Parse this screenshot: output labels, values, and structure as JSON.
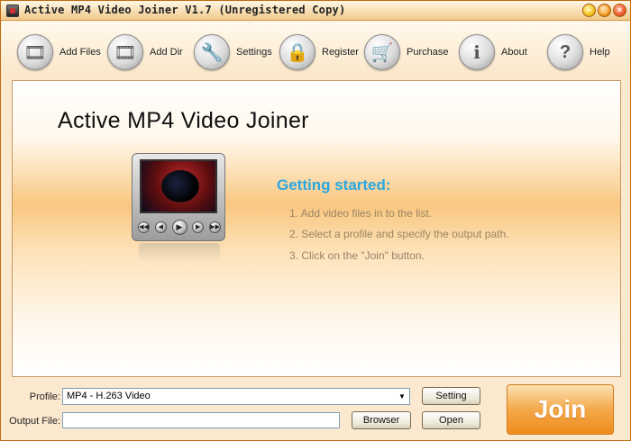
{
  "window": {
    "title": "Active MP4 Video Joiner V1.7 (Unregistered Copy)"
  },
  "toolbar": {
    "items": [
      {
        "label": "Add Files",
        "icon": "film-add-icon"
      },
      {
        "label": "Add Dir",
        "icon": "film-folder-icon"
      },
      {
        "label": "Settings",
        "icon": "wrench-icon"
      },
      {
        "label": "Register",
        "icon": "lock-icon"
      },
      {
        "label": "Purchase",
        "icon": "cart-icon"
      },
      {
        "label": "About",
        "icon": "info-icon"
      },
      {
        "label": "Help",
        "icon": "question-icon"
      }
    ]
  },
  "main": {
    "app_title": "Active MP4 Video Joiner",
    "getting_started": {
      "heading": "Getting started:",
      "steps": [
        "1. Add video files in to the list.",
        "2. Select a profile and specify the output path.",
        "3. Click on the \"Join\" button."
      ]
    }
  },
  "bottom": {
    "profile_label": "Profile:",
    "profile_value": "MP4 - H.263 Video",
    "output_label": "Output File:",
    "output_value": "",
    "setting_button": "Setting",
    "browser_button": "Browser",
    "open_button": "Open",
    "join_button": "Join"
  },
  "colors": {
    "accent_orange": "#f3a84a",
    "heading_blue": "#2aa7e0",
    "step_text": "#9a8566"
  }
}
